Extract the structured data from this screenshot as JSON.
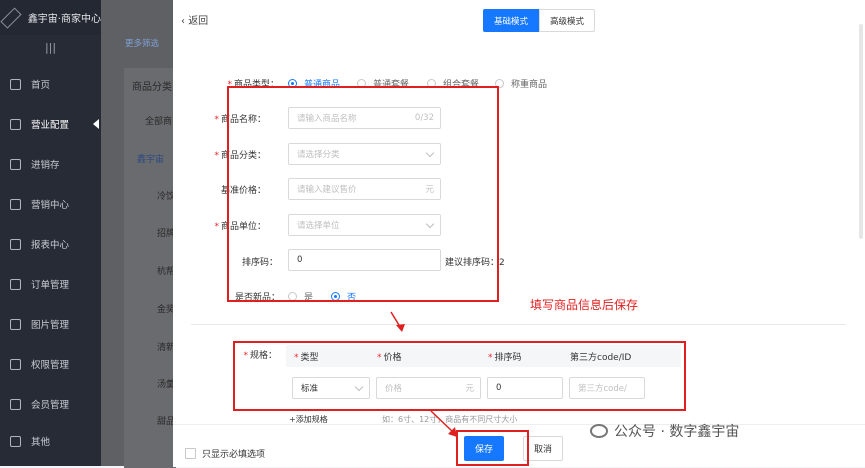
{
  "app": {
    "title": "鑫宇宙·商家中心"
  },
  "sidebar": {
    "items": [
      {
        "label": "首页"
      },
      {
        "label": "营业配置"
      },
      {
        "label": "进销存"
      },
      {
        "label": "营销中心"
      },
      {
        "label": "报表中心"
      },
      {
        "label": "订单管理"
      },
      {
        "label": "图片管理"
      },
      {
        "label": "权限管理"
      },
      {
        "label": "会员管理"
      },
      {
        "label": "其他"
      }
    ]
  },
  "background": {
    "more_filter": "更多筛选",
    "panel_title": "商品分类",
    "tree": [
      "全部商",
      "鑫宇宙",
      "冷饮",
      "招牌",
      "杭帮",
      "金奖",
      "清新",
      "汤羹",
      "甜品"
    ]
  },
  "drawer": {
    "back_label": "返回",
    "modes": [
      "基础模式",
      "高级模式"
    ],
    "product_type": {
      "label": "商品类型：",
      "options": [
        "普通商品",
        "普通套餐",
        "组合套餐",
        "称重商品"
      ],
      "selected": "普通商品"
    },
    "name": {
      "label": "商品名称：",
      "placeholder": "请输入商品名称",
      "counter": "0/32"
    },
    "category": {
      "label": "商品分类：",
      "placeholder": "请选择分类"
    },
    "price": {
      "label": "基准价格：",
      "placeholder": "请输入建议售价",
      "unit": "元"
    },
    "unit": {
      "label": "商品单位：",
      "placeholder": "请选择单位"
    },
    "sort": {
      "label": "排序码：",
      "value": "0",
      "hint": "建议排序码：2"
    },
    "is_new": {
      "label": "是否新品：",
      "options": [
        "是",
        "否"
      ],
      "selected": "否"
    },
    "annotation": "填写商品信息后保存",
    "spec": {
      "label": "规格：",
      "columns": [
        "类型",
        "价格",
        "排序码",
        "第三方code/ID"
      ],
      "row": {
        "type": "标准",
        "price_placeholder": "价格",
        "price_unit": "元",
        "sort": "0",
        "code_placeholder": "第三方code/"
      },
      "add_label": "+添加规格",
      "note": "如：6寸、12寸，商品有不同尺寸大小"
    },
    "footer": {
      "checkbox_label": "只显示必填选项",
      "save": "保存",
      "cancel": "取消"
    }
  },
  "watermark": "公众号 · 数字鑫宇宙",
  "colors": {
    "primary": "#1677ff",
    "annotation": "#e02020",
    "sidebar": "#272b36"
  }
}
